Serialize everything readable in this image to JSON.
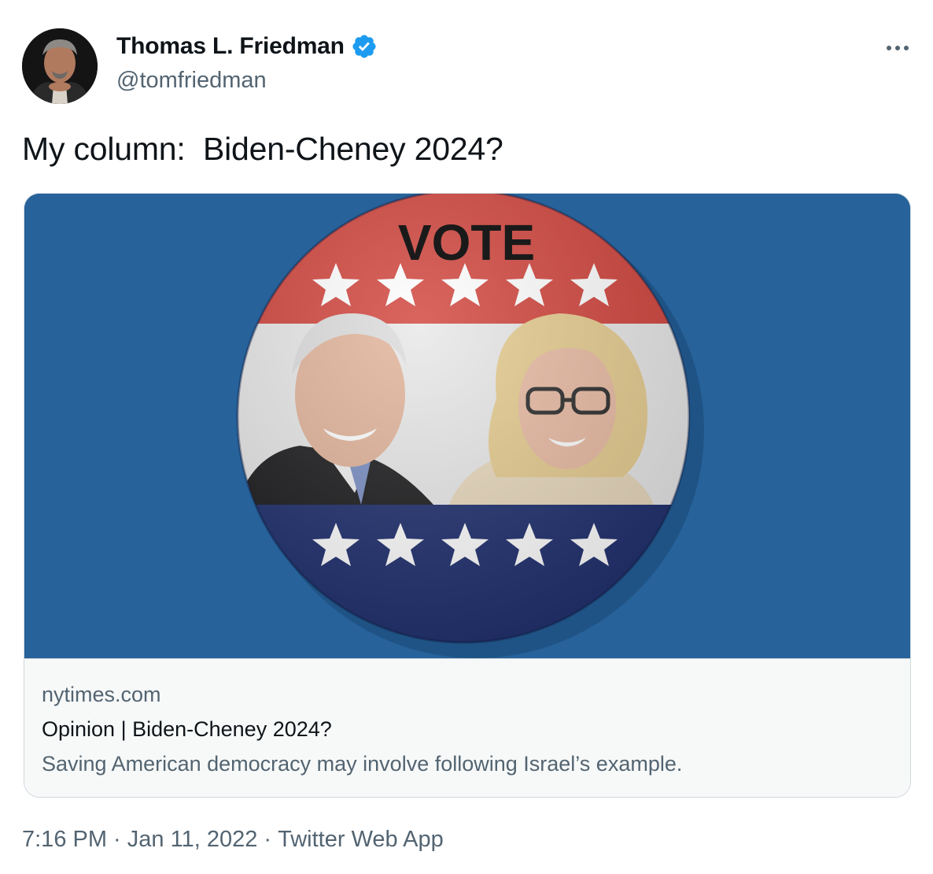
{
  "author": {
    "display_name": "Thomas L. Friedman",
    "handle": "@tomfriedman",
    "verified": true,
    "avatar_icon": "profile-photo"
  },
  "tweet": {
    "text": "My column:  Biden-Cheney 2024?"
  },
  "card": {
    "image_badge_text": "VOTE",
    "domain": "nytimes.com",
    "title": "Opinion | Biden-Cheney 2024?",
    "description": "Saving American democracy may involve following Israel’s example."
  },
  "footer": {
    "time": "7:16 PM",
    "separator": " · ",
    "date": "Jan 11, 2022",
    "source": "Twitter Web App"
  },
  "colors": {
    "verified_blue": "#1d9bf0",
    "image_background": "#27629a",
    "button_red": "#d1443c",
    "button_navy": "#1f2f6e",
    "secondary_text": "#536471"
  },
  "icons": {
    "more": "more-horizontal-icon",
    "verified": "verified-badge-icon"
  }
}
